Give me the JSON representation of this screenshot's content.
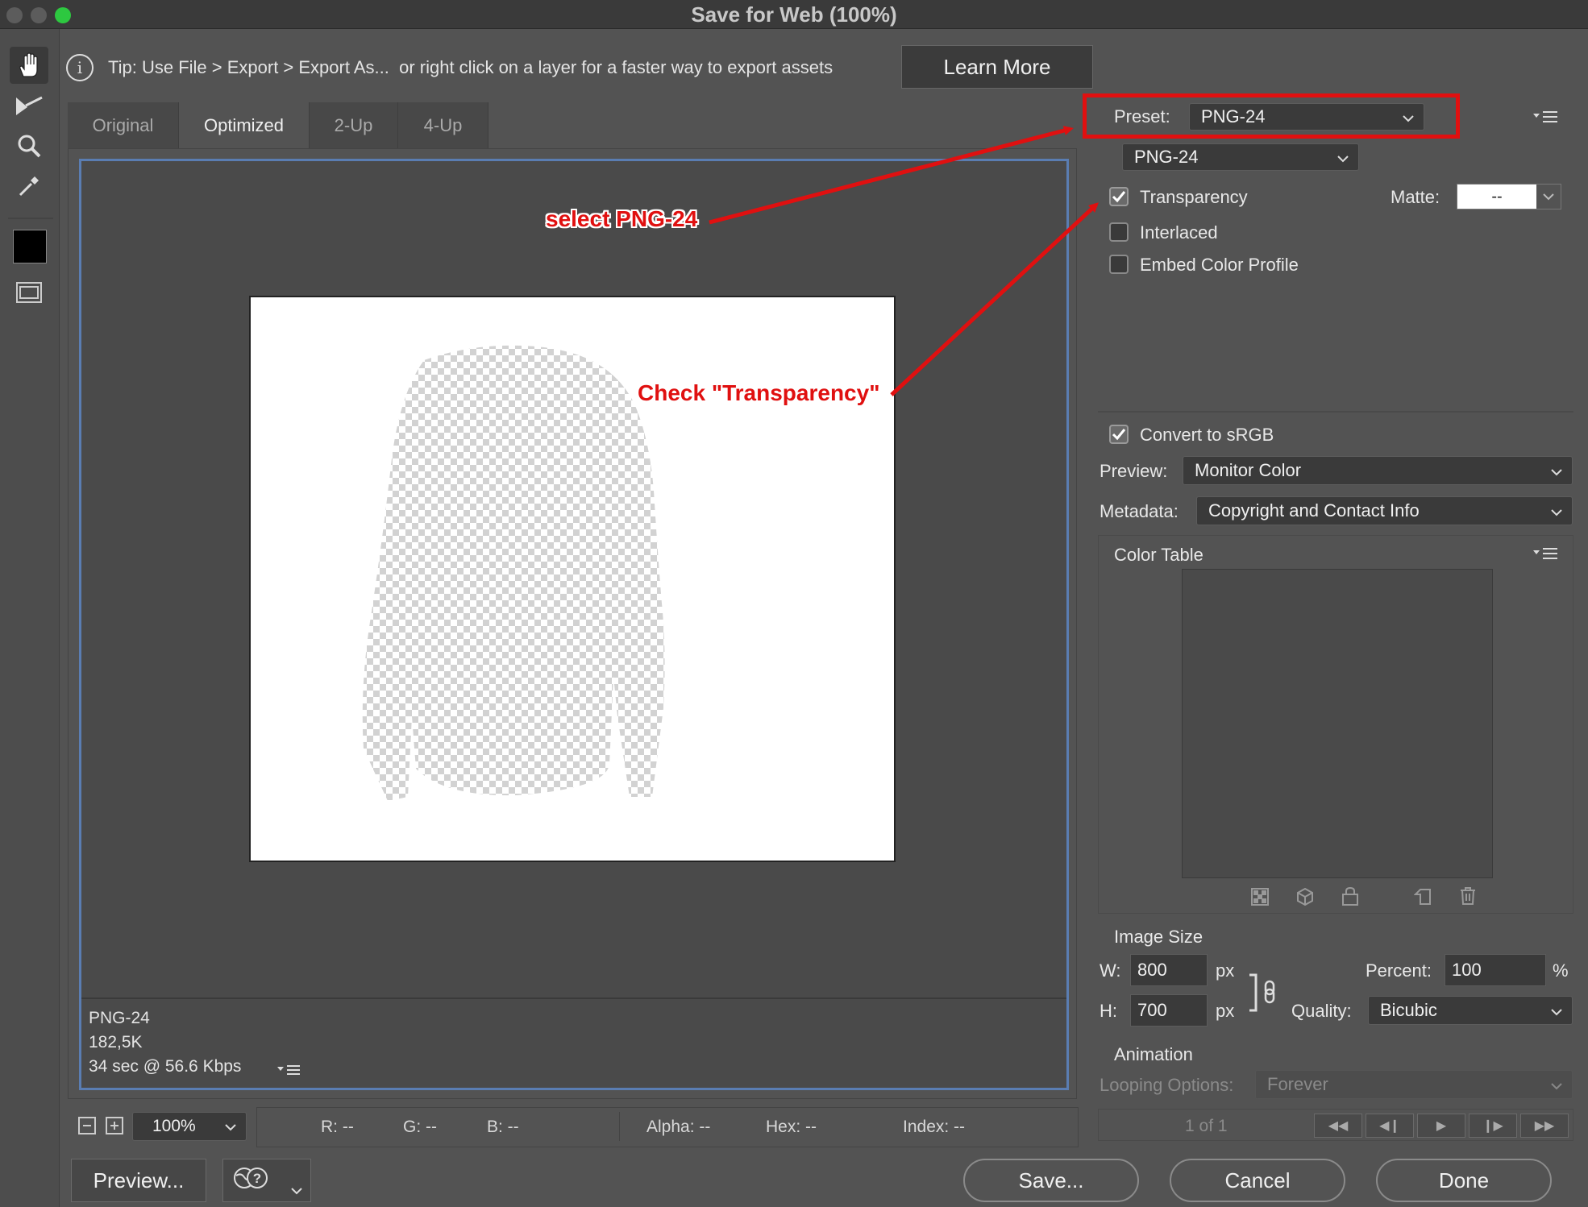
{
  "window": {
    "title": "Save for Web (100%)"
  },
  "tip": {
    "text": "Tip: Use File > Export > Export As...  or right click on a layer for a faster way to export assets",
    "learn_more": "Learn More"
  },
  "tabs": [
    {
      "label": "Original"
    },
    {
      "label": "Optimized"
    },
    {
      "label": "2-Up"
    },
    {
      "label": "4-Up"
    }
  ],
  "image_info": {
    "format": "PNG-24",
    "size": "182,5K",
    "time": "34 sec @ 56.6 Kbps"
  },
  "annotations": {
    "select": "select PNG-24",
    "check": "Check \"Transparency\""
  },
  "settings": {
    "preset_label": "Preset:",
    "preset_value": "PNG-24",
    "format_value": "PNG-24",
    "transparency": "Transparency",
    "matte_label": "Matte:",
    "matte_value": "--",
    "interlaced": "Interlaced",
    "embed_profile": "Embed Color Profile",
    "convert_srgb": "Convert to sRGB",
    "preview_label": "Preview:",
    "preview_value": "Monitor Color",
    "metadata_label": "Metadata:",
    "metadata_value": "Copyright and Contact Info",
    "color_table": "Color Table",
    "image_size": "Image Size",
    "w_label": "W:",
    "w_value": "800",
    "h_label": "H:",
    "h_value": "700",
    "px": "px",
    "percent_label": "Percent:",
    "percent_value": "100",
    "percent_sign": "%",
    "quality_label": "Quality:",
    "quality_value": "Bicubic",
    "animation": "Animation",
    "looping_label": "Looping Options:",
    "looping_value": "Forever",
    "frame_counter": "1 of 1"
  },
  "statusbar": {
    "zoom": "100%",
    "r": "R: --",
    "g": "G: --",
    "b": "B: --",
    "alpha": "Alpha: --",
    "hex": "Hex: --",
    "index": "Index: --"
  },
  "buttons": {
    "preview": "Preview...",
    "save": "Save...",
    "cancel": "Cancel",
    "done": "Done"
  },
  "colors": {
    "annotation_red": "#e01010",
    "panel_bg": "#535353",
    "selection_blue": "#5a7db2"
  }
}
